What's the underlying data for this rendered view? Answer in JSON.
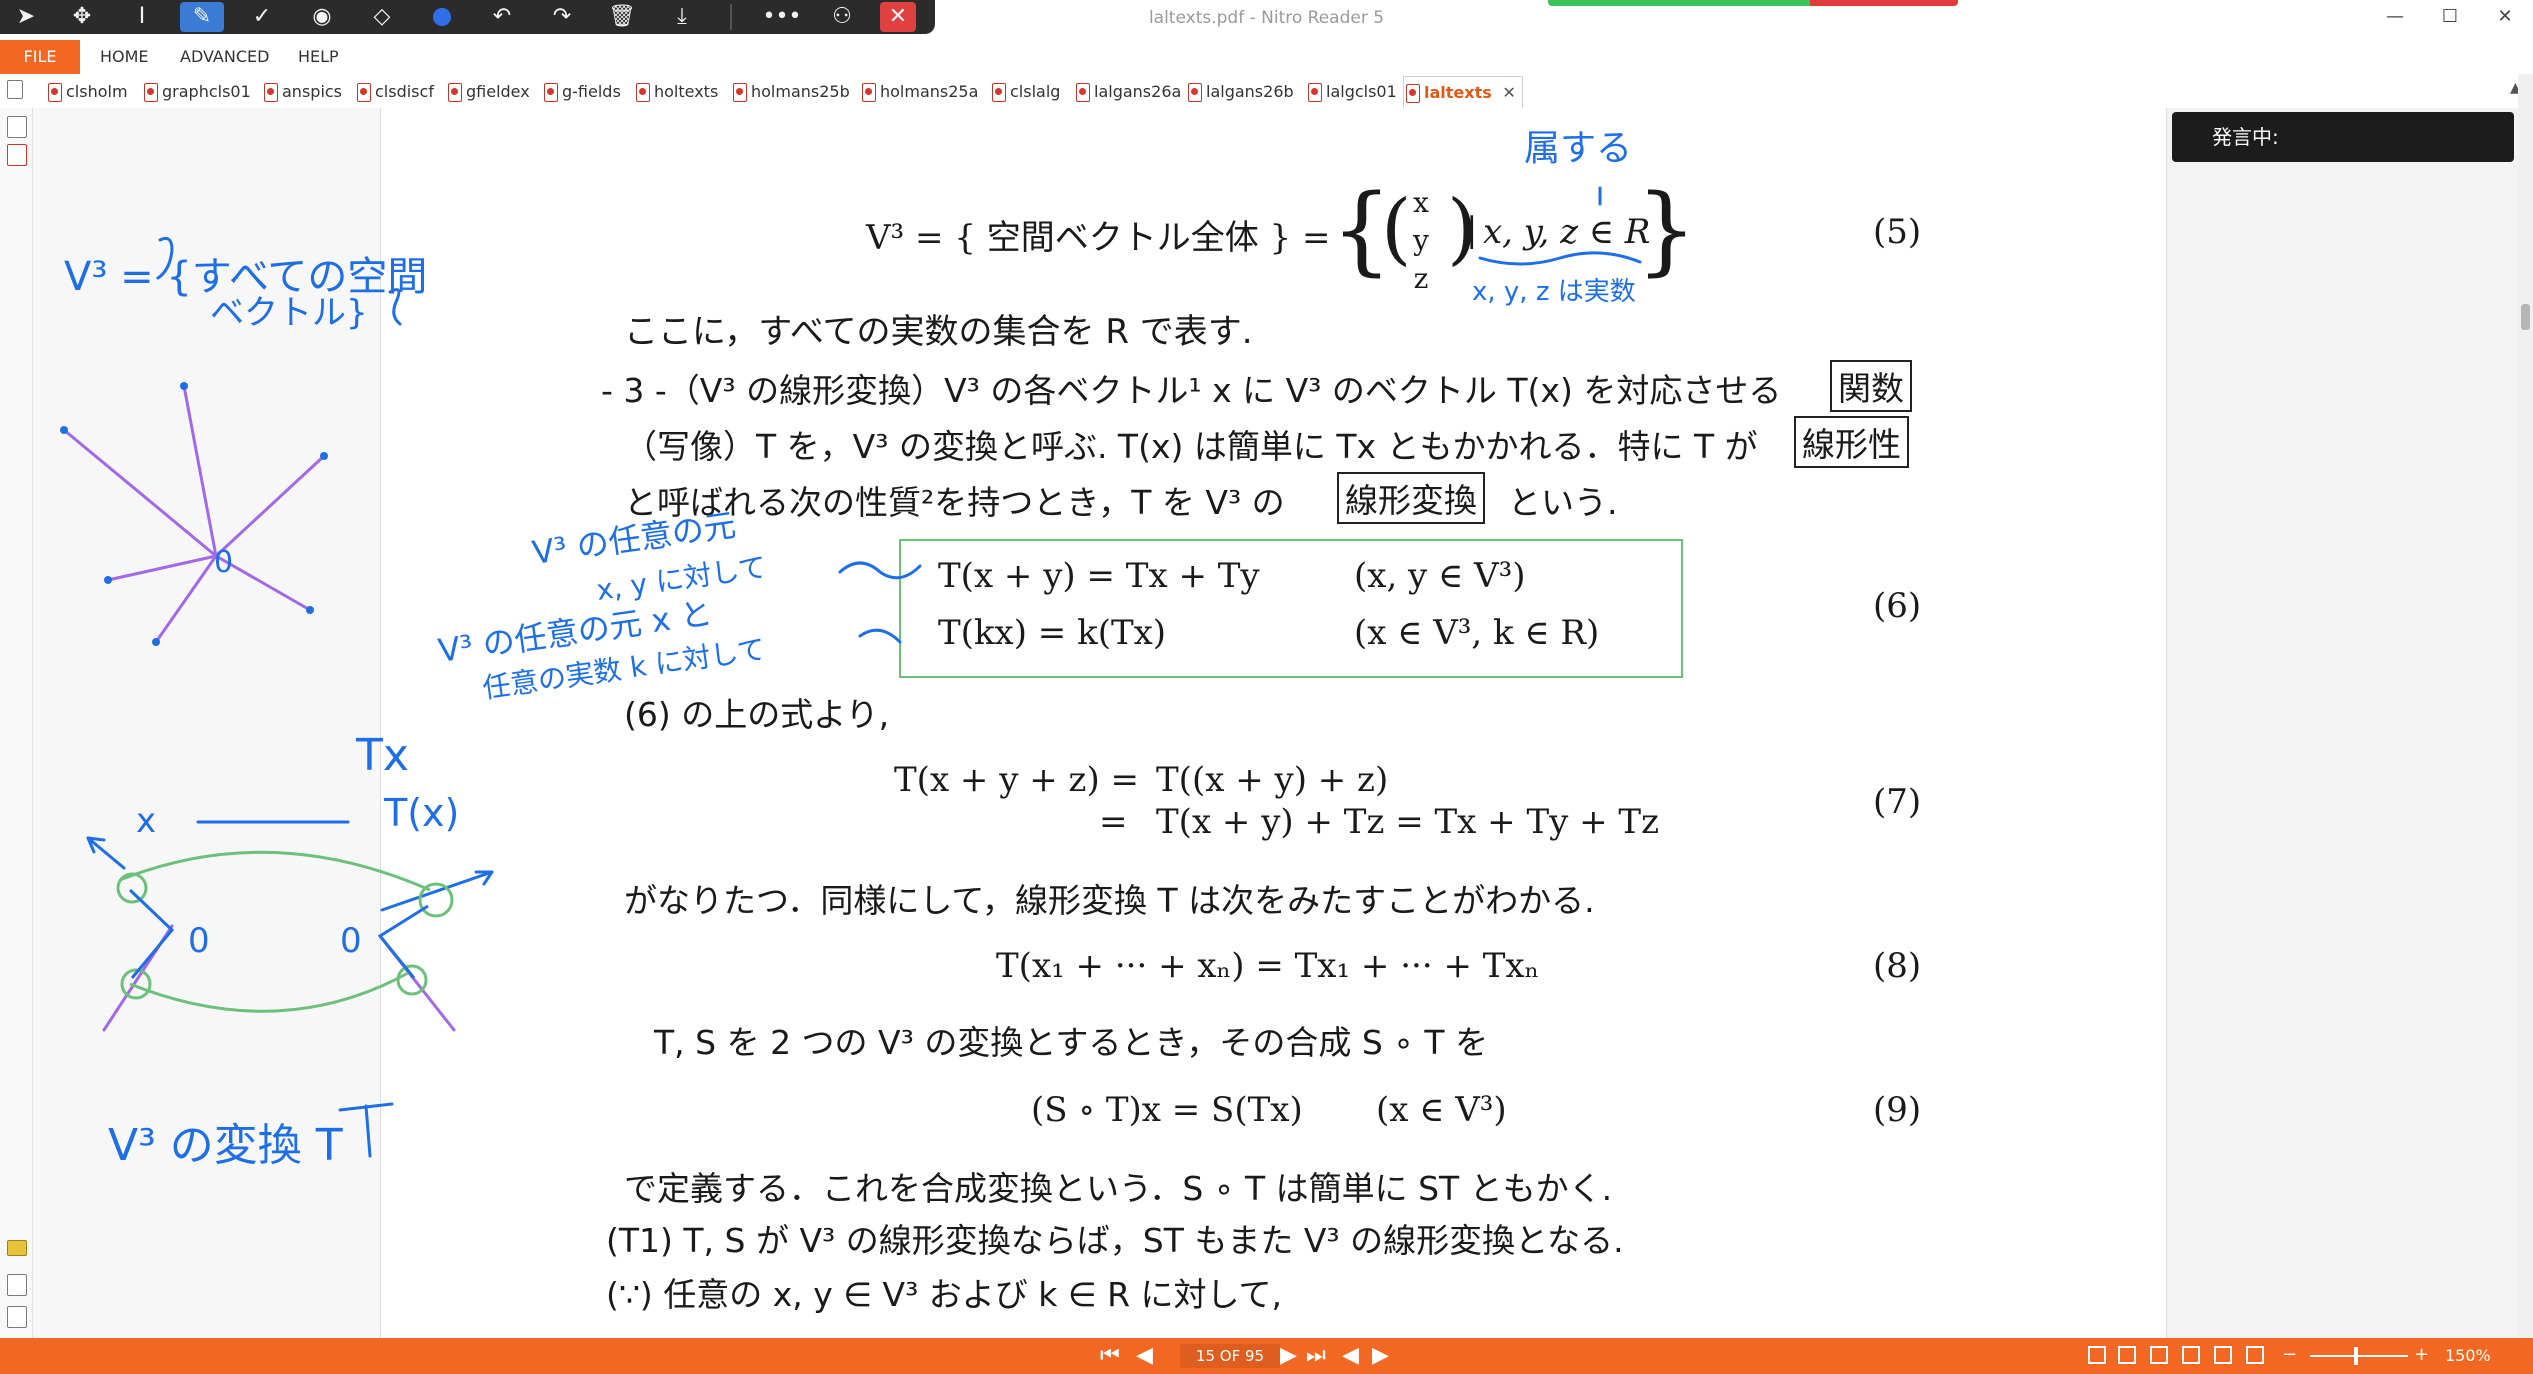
{
  "window": {
    "title": "laltexts.pdf - Nitro Reader 5",
    "controls": {
      "minimize": "—",
      "maximize": "☐",
      "close": "✕"
    }
  },
  "pen_toolbar": {
    "tools": [
      "select-arrow-icon",
      "move-icon",
      "text-cursor-icon",
      "pen-icon",
      "check-icon",
      "highlighter-icon",
      "eraser-icon",
      "color-dot-icon",
      "undo-icon",
      "redo-icon",
      "delete-icon",
      "download-icon",
      "more-icon",
      "user-settings-icon",
      "close-icon"
    ]
  },
  "menu": {
    "file": "FILE",
    "items": [
      "HOME",
      "ADVANCED",
      "HELP"
    ]
  },
  "tabs": [
    {
      "label": "clsholm"
    },
    {
      "label": "graphcls01"
    },
    {
      "label": "anspics"
    },
    {
      "label": "clsdiscf"
    },
    {
      "label": "gfieldex"
    },
    {
      "label": "g-fields"
    },
    {
      "label": "holtexts"
    },
    {
      "label": "holmans25b"
    },
    {
      "label": "holmans25a"
    },
    {
      "label": "clslalg"
    },
    {
      "label": "lalgans26a"
    },
    {
      "label": "lalgans26b"
    },
    {
      "label": "lalgcls01"
    },
    {
      "label": "laltexts",
      "active": true
    }
  ],
  "right_panel": {
    "speaking_label": "発言中:"
  },
  "document": {
    "eq5": {
      "lhs": "V³ = { 空間ベクトル全体 } =",
      "vec": [
        "x",
        "y",
        "z"
      ],
      "condition": "x, y, z ∈ R",
      "number": "(5)"
    },
    "line_reals": "ここに，すべての実数の集合を R で表す.",
    "def3": {
      "line1_pre": "- 3 -（V³ の線形変換）V³ の各ベクトル¹ x に V³ のベクトル T(x) を対応させる",
      "box1": "関数",
      "line2_pre": "（写像）T を，V³ の変換と呼ぶ. T(x) は簡単に Tx ともかかれる．特に T が",
      "box2": "線形性",
      "line3_pre": "と呼ばれる次の性質²を持つとき，T を V³ の",
      "box3": "線形変換",
      "line3_post": "という."
    },
    "eq6": {
      "row1_left": "T(x + y) = Tx + Ty",
      "row1_right": "(x, y ∈ V³)",
      "row2_left": "T(kx) = k(Tx)",
      "row2_right": "(x ∈ V³, k ∈ R)",
      "number": "(6)"
    },
    "from6": "(6) の上の式より,",
    "eq7": {
      "row1_left": "T(x + y + z) =",
      "row1_right": "T((x + y) + z)",
      "row2_left": "=",
      "row2_right": "T(x + y) + Tz = Tx + Ty + Tz",
      "number": "(7)"
    },
    "holds": "がなりたつ．同様にして，線形変換 T は次をみたすことがわかる.",
    "eq8": {
      "text": "T(x₁ + ··· + xₙ) = Tx₁ + ··· + Txₙ",
      "number": "(8)"
    },
    "composition": "T, S を 2 つの V³ の変換とするとき，その合成 S ∘ T を",
    "eq9": {
      "text": "(S ∘ T)x = S(Tx)",
      "cond": "(x ∈ V³)",
      "number": "(9)"
    },
    "defined": "で定義する．これを合成変換という．S ∘ T は簡単に ST ともかく.",
    "t1": "(T1) T, S が V³ の線形変換ならば，ST もまた V³ の線形変換となる.",
    "because": "(∵) 任意の x, y ∈ V³ および k ∈ R に対して,"
  },
  "annotations": {
    "v3_note_1": "V³ = {すべての空間",
    "v3_note_2": "ベクトル}",
    "belongs": "属する",
    "xyz_real": "x, y, z は実数",
    "any_elem_1": "V³ の任意の元",
    "any_elem_2": "x, y に対して",
    "any_elem_3": "V³ の任意の元 x と",
    "any_elem_4": "任意の実数 k に対して",
    "tx": "Tx",
    "tx_paren": "T(x)",
    "x_label": "x",
    "o1": "0",
    "o2": "0",
    "o3": "0",
    "transform": "V³ の変換 T"
  },
  "status": {
    "page_indicator": "15 OF 95",
    "zoom": "150%"
  },
  "colors": {
    "accent": "#f26722",
    "ink_blue": "#1e6fe6",
    "ink_purple": "#a368e8",
    "ink_green": "#6cc07a"
  }
}
